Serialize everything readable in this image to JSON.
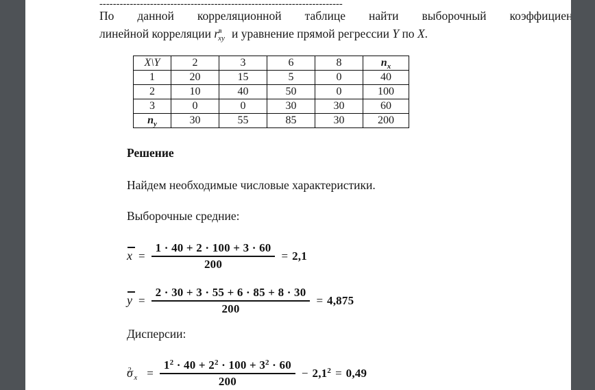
{
  "document": {
    "separator_line": "------------------------------------------------------------------------",
    "problem": {
      "line1": "По данной корреляционной таблице найти выборочный коэффициент",
      "line2_pre": "линейной корреляции ",
      "r_symbol": "r",
      "r_sub": "xy",
      "r_sup": "в",
      "line2_post": " и уравнение прямой регрессии ",
      "var_y": "Y",
      "line2_mid": " по ",
      "var_x": "X",
      "line2_end": "."
    },
    "solution_heading": "Решение",
    "intro_text": "Найдем необходимые числовые характеристики.",
    "means_label": "Выборочные средние:",
    "variance_label": "Дисперсии:"
  },
  "correlation_table": {
    "corner_label": "X\\Y",
    "column_headers": [
      "2",
      "3",
      "6",
      "8"
    ],
    "row_total_header": "n",
    "row_total_sub": "x",
    "col_total_header": "n",
    "col_total_sub": "y",
    "rows": [
      {
        "x": "1",
        "cells": [
          "20",
          "15",
          "5",
          "0"
        ],
        "total": "40"
      },
      {
        "x": "2",
        "cells": [
          "10",
          "40",
          "50",
          "0"
        ],
        "total": "100"
      },
      {
        "x": "3",
        "cells": [
          "0",
          "0",
          "30",
          "30"
        ],
        "total": "60"
      }
    ],
    "column_totals": [
      "30",
      "55",
      "85",
      "30"
    ],
    "grand_total": "200"
  },
  "equations": {
    "x_mean": {
      "lhs": "x",
      "eq_sign": "=",
      "numerator": "1 · 40 + 2 · 100 + 3 · 60",
      "denominator": "200",
      "result_sign": "=",
      "result": "2,1"
    },
    "y_mean": {
      "lhs": "y",
      "eq_sign": "=",
      "numerator": "2 · 30 + 3 · 55 + 6 · 85 + 8 · 30",
      "denominator": "200",
      "result_sign": "=",
      "result": "4,875"
    },
    "sigma_x_squared": {
      "lhs": "σ",
      "lhs_sub": "x",
      "lhs_sup": "2",
      "eq_sign": "=",
      "num_t1_base": "1",
      "num_t1_exp": "2",
      "num_t1_rest": " · 40 + ",
      "num_t2_base": "2",
      "num_t2_exp": "2",
      "num_t2_rest": " · 100 + ",
      "num_t3_base": "3",
      "num_t3_exp": "2",
      "num_t3_rest": " · 60",
      "denominator": "200",
      "minus_sign": "−",
      "sub_base": "2,1",
      "sub_exp": "2",
      "result_sign": "=",
      "result": "0,49"
    }
  },
  "colors": {
    "page_background": "#ffffff",
    "gutter": "#4e5256",
    "text": "#181818",
    "table_border": "#0a0a0a"
  }
}
